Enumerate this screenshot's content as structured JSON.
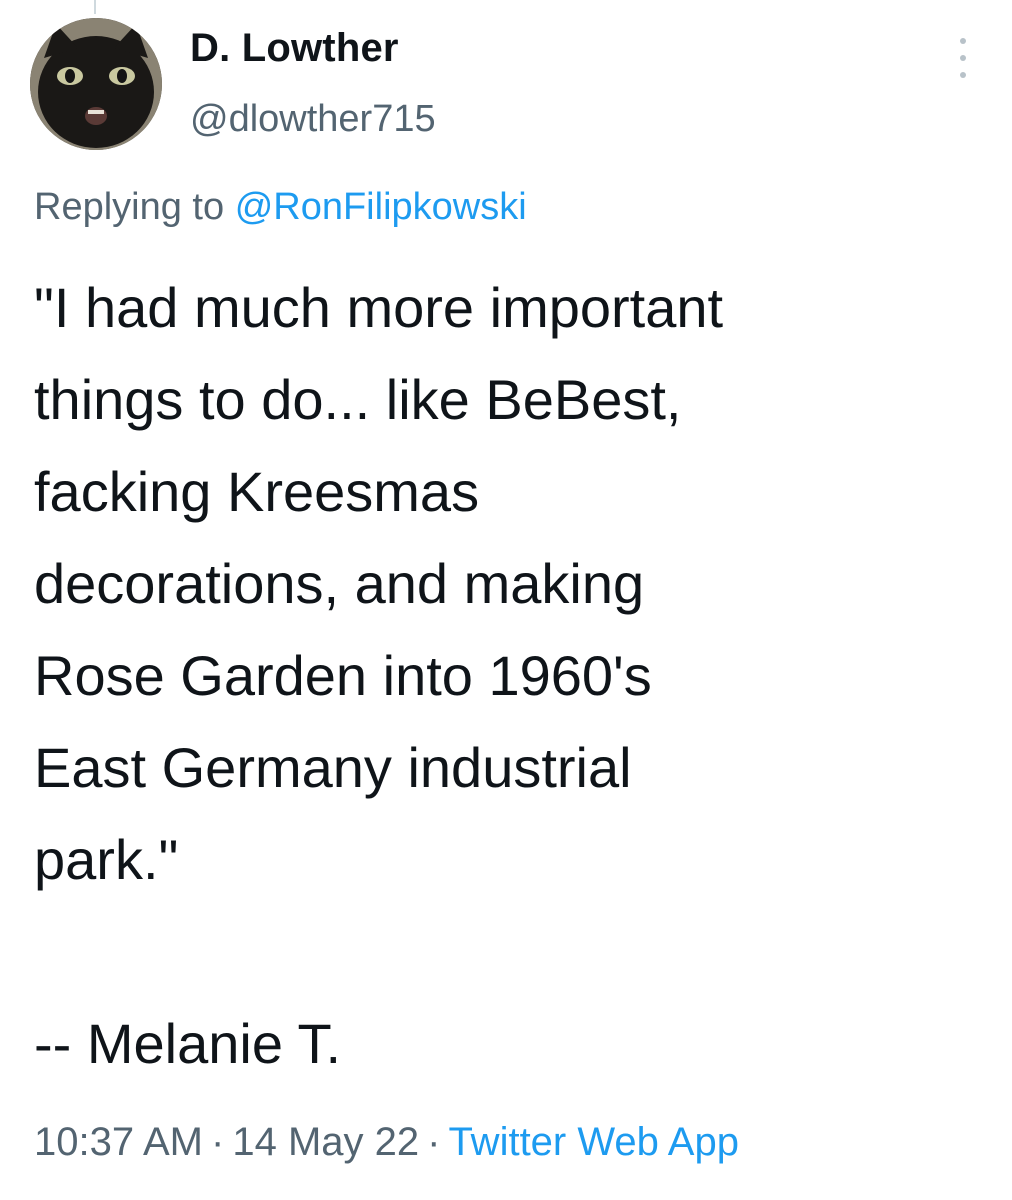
{
  "tweet": {
    "author": {
      "display_name": "D. Lowther",
      "handle": "@dlowther715",
      "avatar_icon": "black-cat-avatar"
    },
    "replying_prefix": "Replying to",
    "replying_to": "@RonFilipkowski",
    "body_lines": [
      "\"I had much more important",
      "things to do... like BeBest,",
      "facking Kreesmas",
      "decorations, and making",
      "Rose Garden into 1960's",
      "East Germany industrial",
      "park.\"",
      "",
      "-- Melanie T."
    ],
    "time": "10:37 AM",
    "date": "14 May 22",
    "separator": "·",
    "source": "Twitter Web App"
  },
  "colors": {
    "text": "#0f1419",
    "secondary": "#536471",
    "link": "#1d9bf0"
  }
}
